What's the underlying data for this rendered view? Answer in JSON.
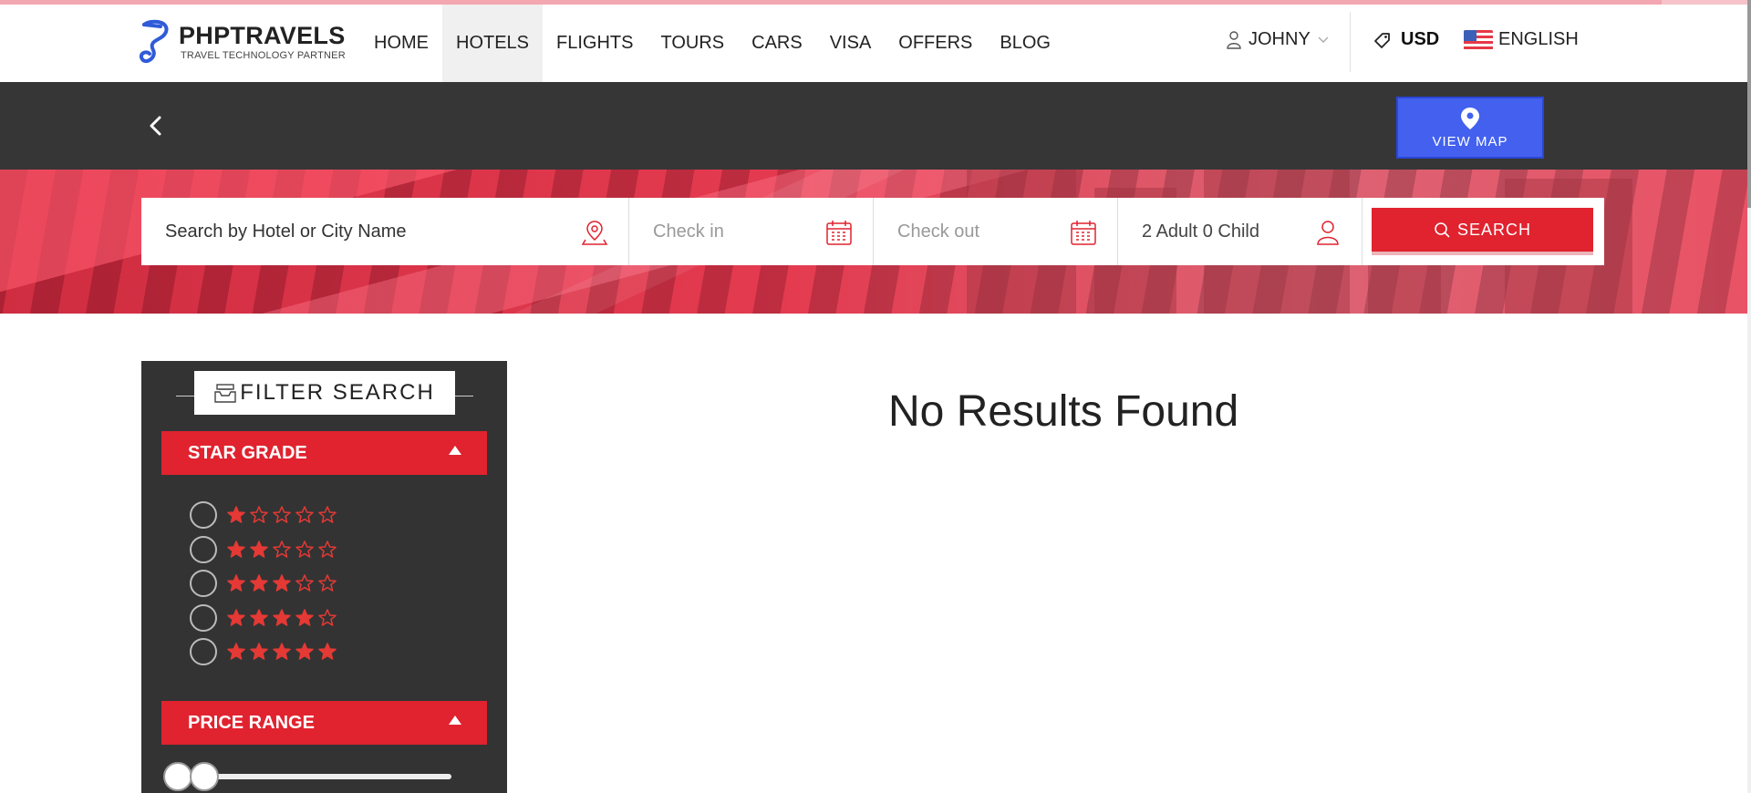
{
  "header": {
    "logo": {
      "name": "PHPTRAVELS",
      "tagline": "TRAVEL TECHNOLOGY PARTNER"
    },
    "nav": [
      {
        "label": "HOME",
        "active": false
      },
      {
        "label": "HOTELS",
        "active": true
      },
      {
        "label": "FLIGHTS",
        "active": false
      },
      {
        "label": "TOURS",
        "active": false
      },
      {
        "label": "CARS",
        "active": false
      },
      {
        "label": "VISA",
        "active": false
      },
      {
        "label": "OFFERS",
        "active": false
      },
      {
        "label": "BLOG",
        "active": false
      }
    ],
    "user": "JOHNY",
    "currency": "USD",
    "language": "ENGLISH"
  },
  "toolbar": {
    "view_map_label": "VIEW MAP"
  },
  "search": {
    "hotel_placeholder": "Search by Hotel or City Name",
    "checkin_placeholder": "Check in",
    "checkout_placeholder": "Check out",
    "guests": "2 Adult 0 Child",
    "button_label": "SEARCH"
  },
  "filter": {
    "title": "FILTER SEARCH",
    "star_grade": {
      "label": "STAR GRADE",
      "options": [
        1,
        2,
        3,
        4,
        5
      ]
    },
    "price_range": {
      "label": "PRICE RANGE"
    }
  },
  "results": {
    "message": "No Results Found"
  },
  "colors": {
    "accent": "#e0232f",
    "map_button": "#4361ee",
    "dark_bar": "#363636",
    "sidebar": "#333333",
    "star": "#e53935"
  }
}
